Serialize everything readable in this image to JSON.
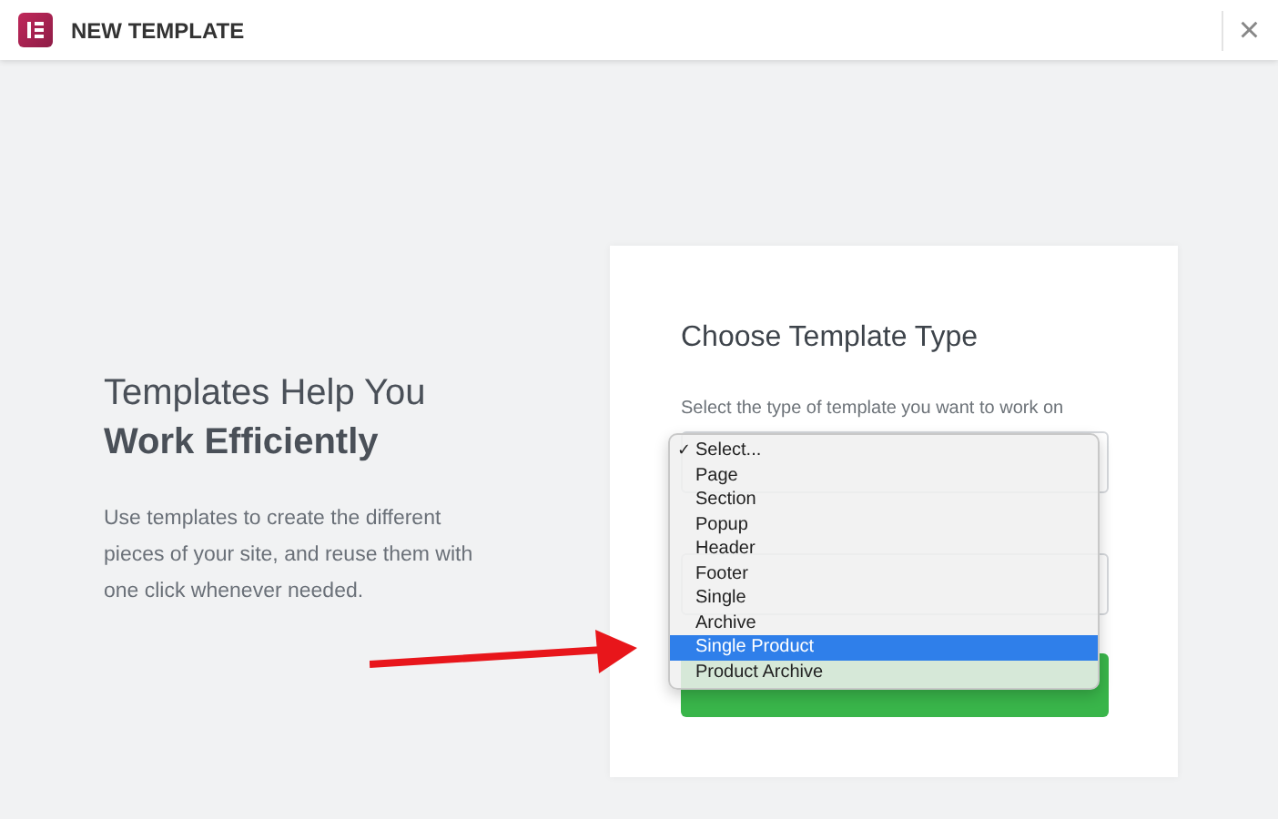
{
  "window": {
    "title": "NEW TEMPLATE",
    "close": "×"
  },
  "intro": {
    "title": "Templates Help You",
    "subtitle": "Work Efficiently",
    "text": "Use templates to create the different pieces of your site, and reuse them with one click whenever needed."
  },
  "form": {
    "title": "Choose Template Type",
    "label": "Select the type of template you want to work on"
  },
  "dropdown": {
    "check_mark": "✓",
    "options": [
      {
        "label": "Select...",
        "checked": true,
        "selected": false
      },
      {
        "label": "Page",
        "checked": false,
        "selected": false
      },
      {
        "label": "Section",
        "checked": false,
        "selected": false
      },
      {
        "label": "Popup",
        "checked": false,
        "selected": false
      },
      {
        "label": "Header",
        "checked": false,
        "selected": false
      },
      {
        "label": "Footer",
        "checked": false,
        "selected": false
      },
      {
        "label": "Single",
        "checked": false,
        "selected": false
      },
      {
        "label": "Archive",
        "checked": false,
        "selected": false
      },
      {
        "label": "Single Product",
        "checked": false,
        "selected": true
      },
      {
        "label": "Product Archive",
        "checked": false,
        "selected": false
      }
    ]
  }
}
